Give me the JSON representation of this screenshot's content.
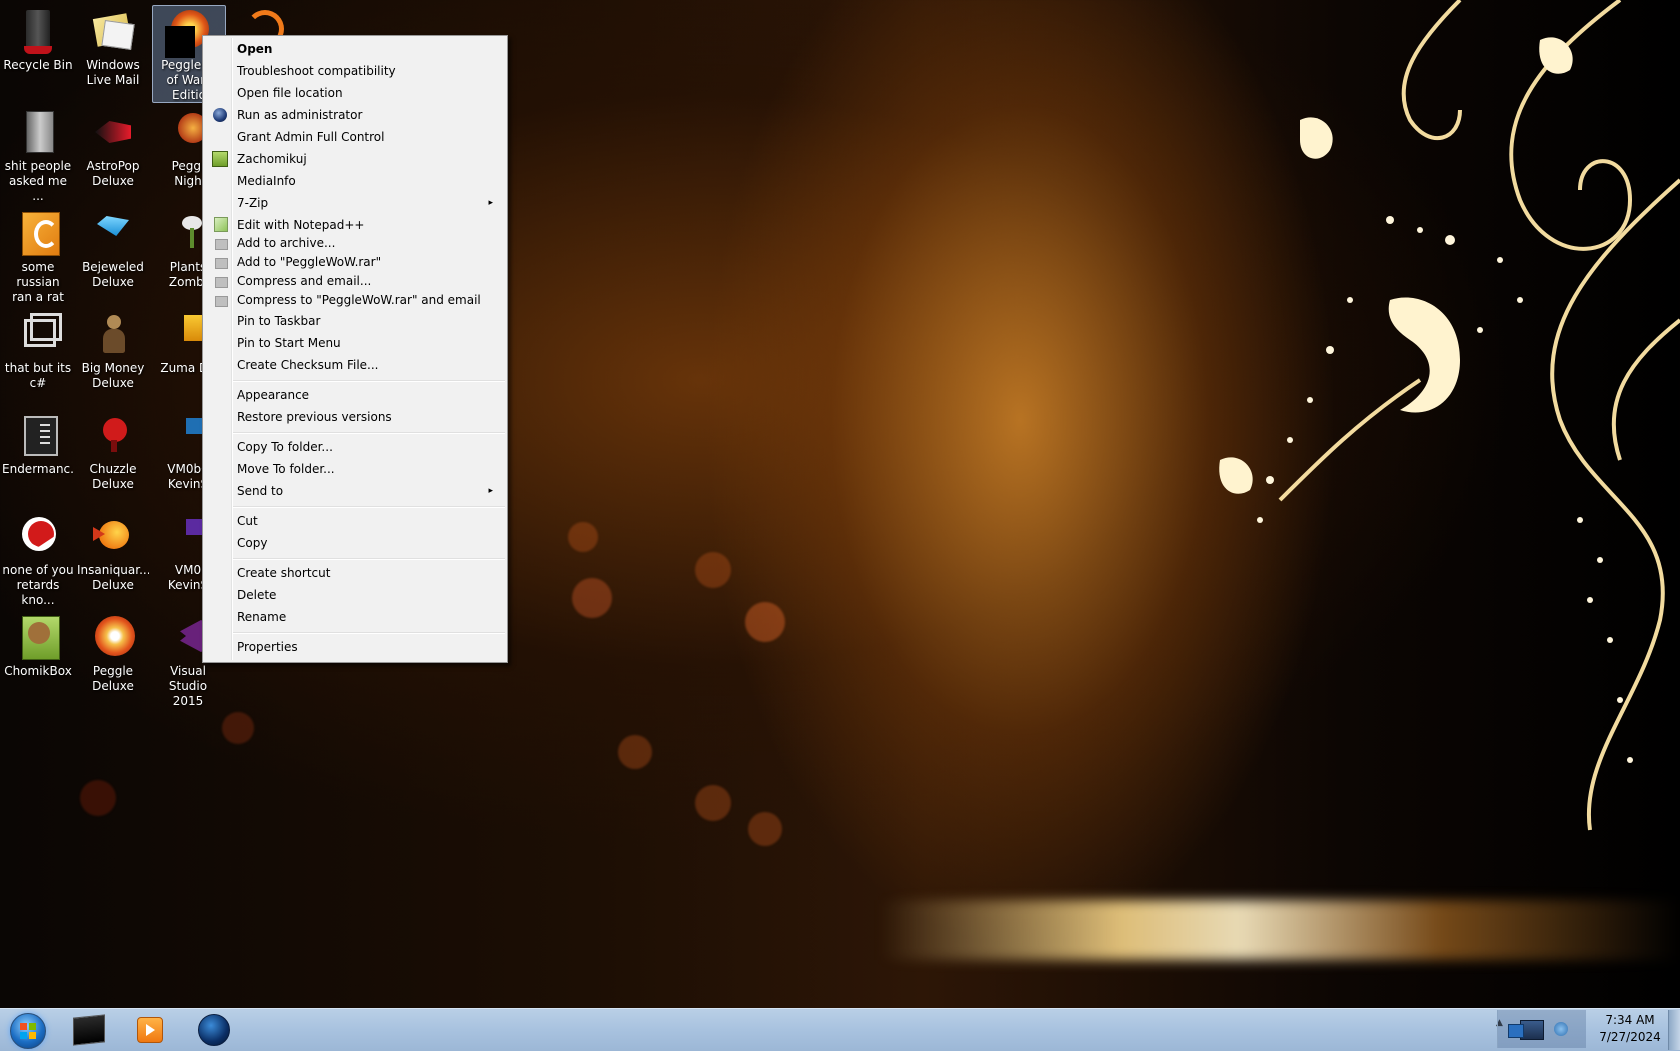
{
  "desktop": {
    "icons": [
      {
        "label": "Recycle Bin",
        "icon": "recycle-bin-icon"
      },
      {
        "label": "Windows\nLive Mail",
        "icon": "live-mail-icon"
      },
      {
        "label": "Peggle W\nof Warc\nEditio",
        "icon": "peggle-wow-icon"
      },
      {
        "label": "shit people\nasked me ...",
        "icon": "file-icon"
      },
      {
        "label": "AstroPop\nDeluxe",
        "icon": "astropop-icon"
      },
      {
        "label": "Peggl\nNigh",
        "icon": "peggle-nights-icon"
      },
      {
        "label": "some russian\nran a rat",
        "icon": "folder-icon"
      },
      {
        "label": "Bejeweled\nDeluxe",
        "icon": "bejeweled-icon"
      },
      {
        "label": "Plants\nZombi",
        "icon": "plants-zombies-icon"
      },
      {
        "label": "that but its\nc#",
        "icon": "file-icon"
      },
      {
        "label": "Big Money\nDeluxe",
        "icon": "big-money-icon"
      },
      {
        "label": "Zuma De",
        "icon": "zuma-icon"
      },
      {
        "label": "Endermanc...",
        "icon": "document-icon"
      },
      {
        "label": "Chuzzle\nDeluxe",
        "icon": "chuzzle-icon"
      },
      {
        "label": "VM0b0\nKevinS",
        "icon": "vm-icon"
      },
      {
        "label": "none of you\nretards kno...",
        "icon": "image-icon"
      },
      {
        "label": "Insaniquar...\nDeluxe",
        "icon": "insaniquarium-icon"
      },
      {
        "label": "VM0\nKevinS",
        "icon": "vm-icon"
      },
      {
        "label": "ChomikBox",
        "icon": "chomikbox-icon"
      },
      {
        "label": "Peggle\nDeluxe",
        "icon": "peggle-icon"
      },
      {
        "label": "Visual Studio\n2015",
        "icon": "visual-studio-icon"
      }
    ]
  },
  "context_menu": {
    "items": [
      {
        "label": "Open"
      },
      {
        "label": "Troubleshoot compatibility"
      },
      {
        "label": "Open file location"
      },
      {
        "label": "Run as administrator"
      },
      {
        "label": "Grant Admin Full Control"
      },
      {
        "label": "Zachomikuj"
      },
      {
        "label": "MediaInfo"
      },
      {
        "label": "7-Zip"
      },
      {
        "label": "Edit with Notepad++"
      },
      {
        "label": "Add to archive..."
      },
      {
        "label": "Add to \"PeggleWoW.rar\""
      },
      {
        "label": "Compress and email..."
      },
      {
        "label": "Compress to \"PeggleWoW.rar\" and email"
      },
      {
        "label": "Pin to Taskbar"
      },
      {
        "label": "Pin to Start Menu"
      },
      {
        "label": "Create Checksum File..."
      },
      {
        "label": "Appearance"
      },
      {
        "label": "Restore previous versions"
      },
      {
        "label": "Copy To folder..."
      },
      {
        "label": "Move To folder..."
      },
      {
        "label": "Send to"
      },
      {
        "label": "Cut"
      },
      {
        "label": "Copy"
      },
      {
        "label": "Create shortcut"
      },
      {
        "label": "Delete"
      },
      {
        "label": "Rename"
      },
      {
        "label": "Properties"
      }
    ],
    "submenu_arrow": "▸"
  },
  "taskbar": {
    "start_icon": "windows-start-icon",
    "pinned": [
      {
        "icon": "command-prompt-icon"
      },
      {
        "icon": "media-player-icon"
      },
      {
        "icon": "globe-browser-icon"
      }
    ],
    "tray_expand": "▲",
    "clock": {
      "time": "7:34 AM",
      "date": "7/27/2024"
    }
  },
  "colors": {
    "menu_bg": "#f1f1f1",
    "taskbar": "#a8c2df",
    "selection": "#789ebe"
  }
}
